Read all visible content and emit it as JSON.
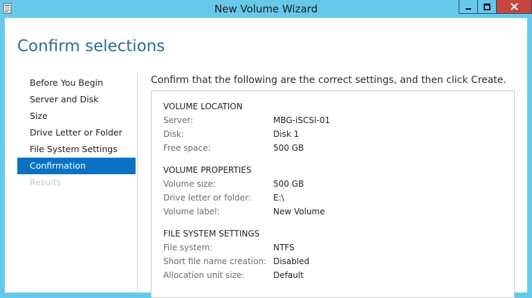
{
  "window": {
    "title": "New Volume Wizard",
    "icon": "wizard-app-icon",
    "controls": [
      "minimize-icon",
      "maximize-icon",
      "close-icon"
    ],
    "accent": "#68c8ea",
    "close_color": "#c7453a"
  },
  "page": {
    "title": "Confirm selections",
    "title_color": "#2a6e8a",
    "instruction": "Confirm that the following are the correct settings, and then click Create."
  },
  "nav": {
    "items": [
      {
        "label": "Before You Begin",
        "state": "normal"
      },
      {
        "label": "Server and Disk",
        "state": "normal"
      },
      {
        "label": "Size",
        "state": "normal"
      },
      {
        "label": "Drive Letter or Folder",
        "state": "normal"
      },
      {
        "label": "File System Settings",
        "state": "normal"
      },
      {
        "label": "Confirmation",
        "state": "active"
      },
      {
        "label": "Results",
        "state": "disabled"
      }
    ],
    "active_color": "#0a72c4"
  },
  "summary": {
    "sections": [
      {
        "heading": "VOLUME LOCATION",
        "rows": [
          {
            "label": "Server:",
            "value": "MBG-iSCSI-01"
          },
          {
            "label": "Disk:",
            "value": "Disk 1"
          },
          {
            "label": "Free space:",
            "value": "500 GB"
          }
        ]
      },
      {
        "heading": "VOLUME PROPERTIES",
        "rows": [
          {
            "label": "Volume size:",
            "value": "500 GB"
          },
          {
            "label": "Drive letter or folder:",
            "value": "E:\\"
          },
          {
            "label": "Volume label:",
            "value": "New Volume"
          }
        ]
      },
      {
        "heading": "FILE SYSTEM SETTINGS",
        "rows": [
          {
            "label": "File system:",
            "value": "NTFS"
          },
          {
            "label": "Short file name creation:",
            "value": "Disabled"
          },
          {
            "label": "Allocation unit size:",
            "value": "Default"
          }
        ]
      }
    ]
  }
}
